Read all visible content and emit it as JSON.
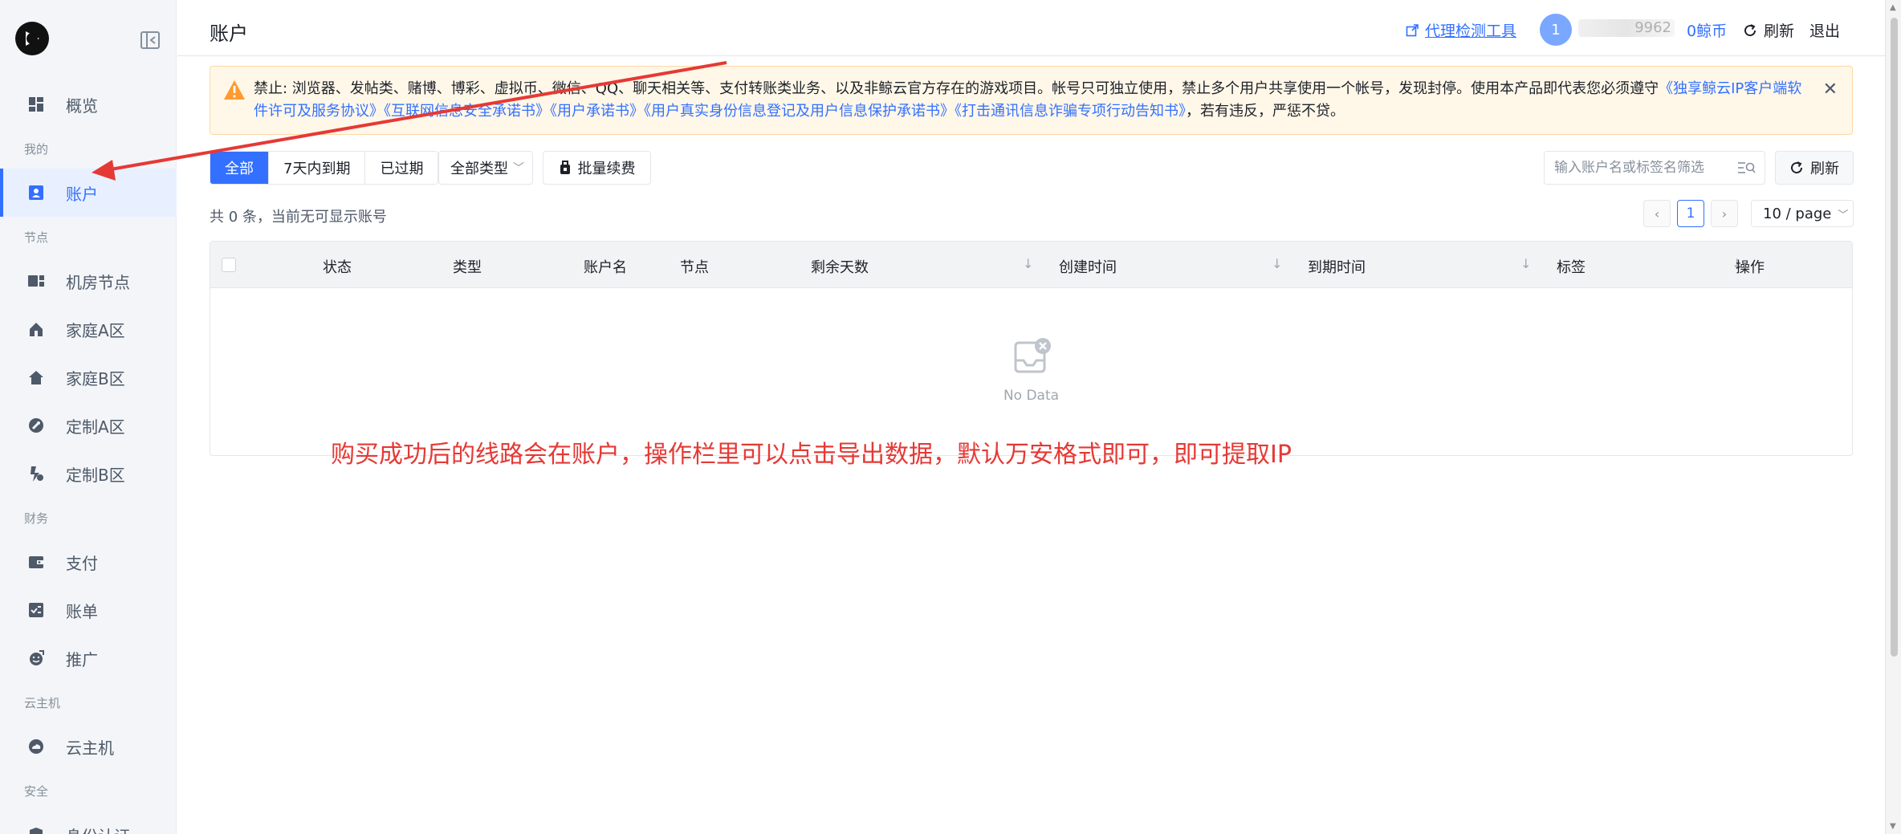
{
  "sidebar": {
    "items": [
      {
        "label": "概览",
        "icon": "dashboard-icon"
      },
      {
        "group": "我的"
      },
      {
        "label": "账户",
        "icon": "account-icon",
        "active": true
      },
      {
        "group": "节点"
      },
      {
        "label": "机房节点",
        "icon": "server-icon"
      },
      {
        "label": "家庭A区",
        "icon": "home-icon"
      },
      {
        "label": "家庭B区",
        "icon": "home-icon"
      },
      {
        "label": "定制A区",
        "icon": "wrench-icon"
      },
      {
        "label": "定制B区",
        "icon": "hand-icon"
      },
      {
        "group": "财务"
      },
      {
        "label": "支付",
        "icon": "wallet-icon"
      },
      {
        "label": "账单",
        "icon": "bill-icon"
      },
      {
        "label": "推广",
        "icon": "promote-icon"
      },
      {
        "group": "云主机"
      },
      {
        "label": "云主机",
        "icon": "cloud-icon"
      },
      {
        "group": "安全"
      },
      {
        "label": "身份认证",
        "icon": "shield-icon"
      }
    ]
  },
  "header": {
    "title": "账户",
    "proxy_tool": "代理检测工具",
    "avatar_text": "1",
    "user_masked": "9962",
    "coins": "0鲸币",
    "refresh": "刷新",
    "logout": "退出"
  },
  "notice": {
    "prefix": "禁止: 浏览器、发帖类、赌博、博彩、虚拟币、微信、QQ、聊天相关等、支付转账类业务、以及非鲸云官方存在的游戏项目。帐号只可独立使用，禁止多个用户共享使用一个帐号，发现封停。使用本产品即代表您必须遵守",
    "link1": "《独享鲸云IP客户端软件许可及服务协议》",
    "link2": "《互联网信息安全承诺书》",
    "link3": "《用户承诺书》",
    "link4": "《用户真实身份信息登记及用户信息保护承诺书》",
    "link5": "《打击通讯信息诈骗专项行动告知书》",
    "suffix": "，若有违反，严惩不贷。",
    "close": "✕"
  },
  "filters": {
    "tabs": [
      "全部",
      "7天内到期",
      "已过期"
    ],
    "type_select": "全部类型",
    "batch_renew": "批量续费",
    "search_placeholder": "输入账户名或标签名筛选",
    "refresh": "刷新"
  },
  "summary": "共 0 条，当前无可显示账号",
  "pagination": {
    "prev": "‹",
    "current": "1",
    "next": "›",
    "page_size": "10 / page"
  },
  "table": {
    "columns": [
      "状态",
      "类型",
      "账户名",
      "节点",
      "剩余天数",
      "创建时间",
      "到期时间",
      "标签",
      "操作"
    ],
    "empty_text": "No Data"
  },
  "annotation": "购买成功后的线路会在账户，操作栏里可以点击导出数据，默认万安格式即可，即可提取IP",
  "colors": {
    "accent": "#3370ff",
    "annotation": "#e53935",
    "notice_bg": "#fff7e8"
  }
}
